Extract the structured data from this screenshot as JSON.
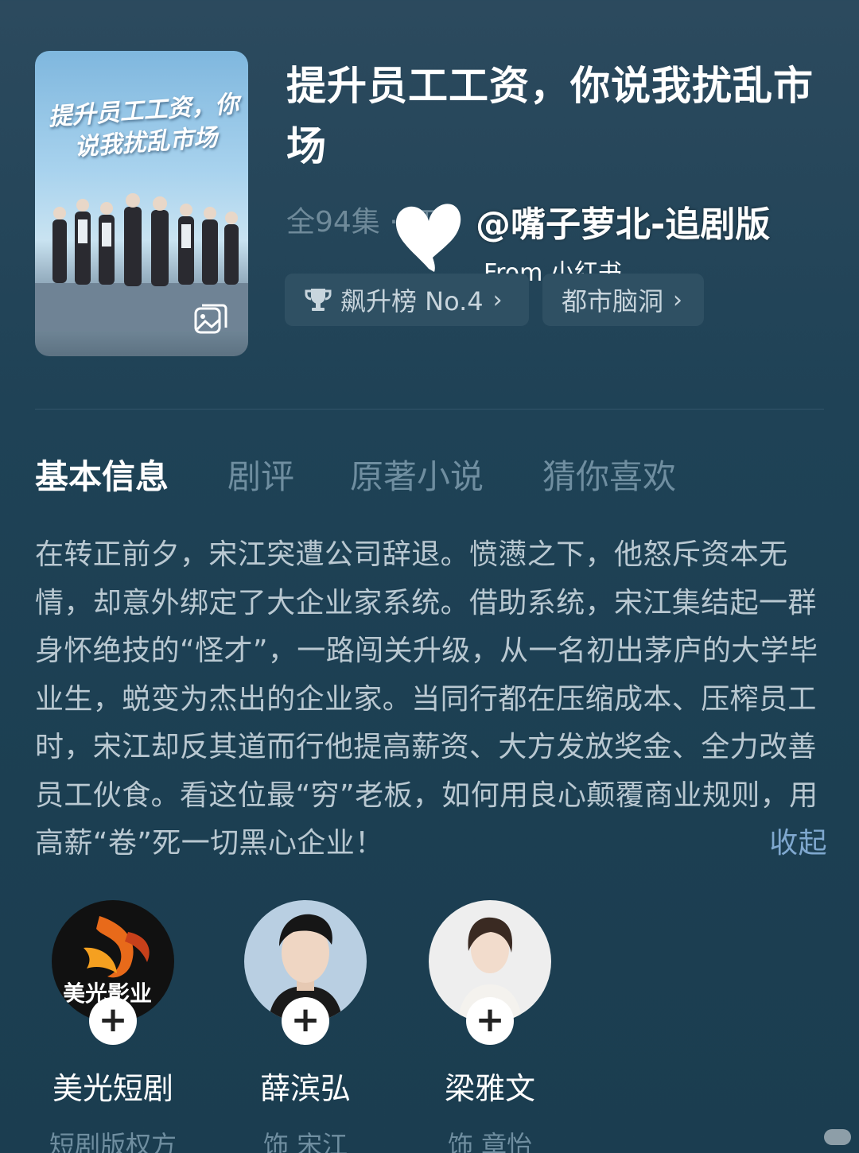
{
  "drama": {
    "title": "提升员工工资，你说我扰乱市场",
    "poster_title": "提升员工工资，你说我扰乱市场",
    "episodes": "全94集 · 红",
    "rank_tag": "飙升榜 No.4",
    "genre_tag": "都市脑洞"
  },
  "watermark": {
    "handle": "@嘴子萝北-追剧版",
    "source": "From 小红书"
  },
  "tabs": [
    {
      "label": "基本信息",
      "active": true
    },
    {
      "label": "剧评",
      "active": false
    },
    {
      "label": "原著小说",
      "active": false
    },
    {
      "label": "猜你喜欢",
      "active": false
    }
  ],
  "synopsis": {
    "text": "在转正前夕，宋江突遭公司辞退。愤懑之下，他怒斥资本无情，却意外绑定了大企业家系统。借助系统，宋江集结起一群身怀绝技的“怪才”，一路闯关升级，从一名初出茅庐的大学毕业生，蜕变为杰出的企业家。当同行都在压缩成本、压榨员工时，宋江却反其道而行他提高薪资、大方发放奖金、全力改善员工伙食。看这位最“穷”老板，如何用良心颠覆商业规则，用高薪“卷”死一切黑心企业！",
    "collapse_label": "收起"
  },
  "people": [
    {
      "name": "美光短剧",
      "role": "短剧版权方",
      "logo_text": "美光影业"
    },
    {
      "name": "薛滨弘",
      "role": "饰 宋江"
    },
    {
      "name": "梁雅文",
      "role": "饰 章怡"
    }
  ],
  "follow_label": "+",
  "colors": {
    "accent_link": "#7fa8cf",
    "muted": "#6f8ea0",
    "tag_bg": "#2f5063"
  }
}
